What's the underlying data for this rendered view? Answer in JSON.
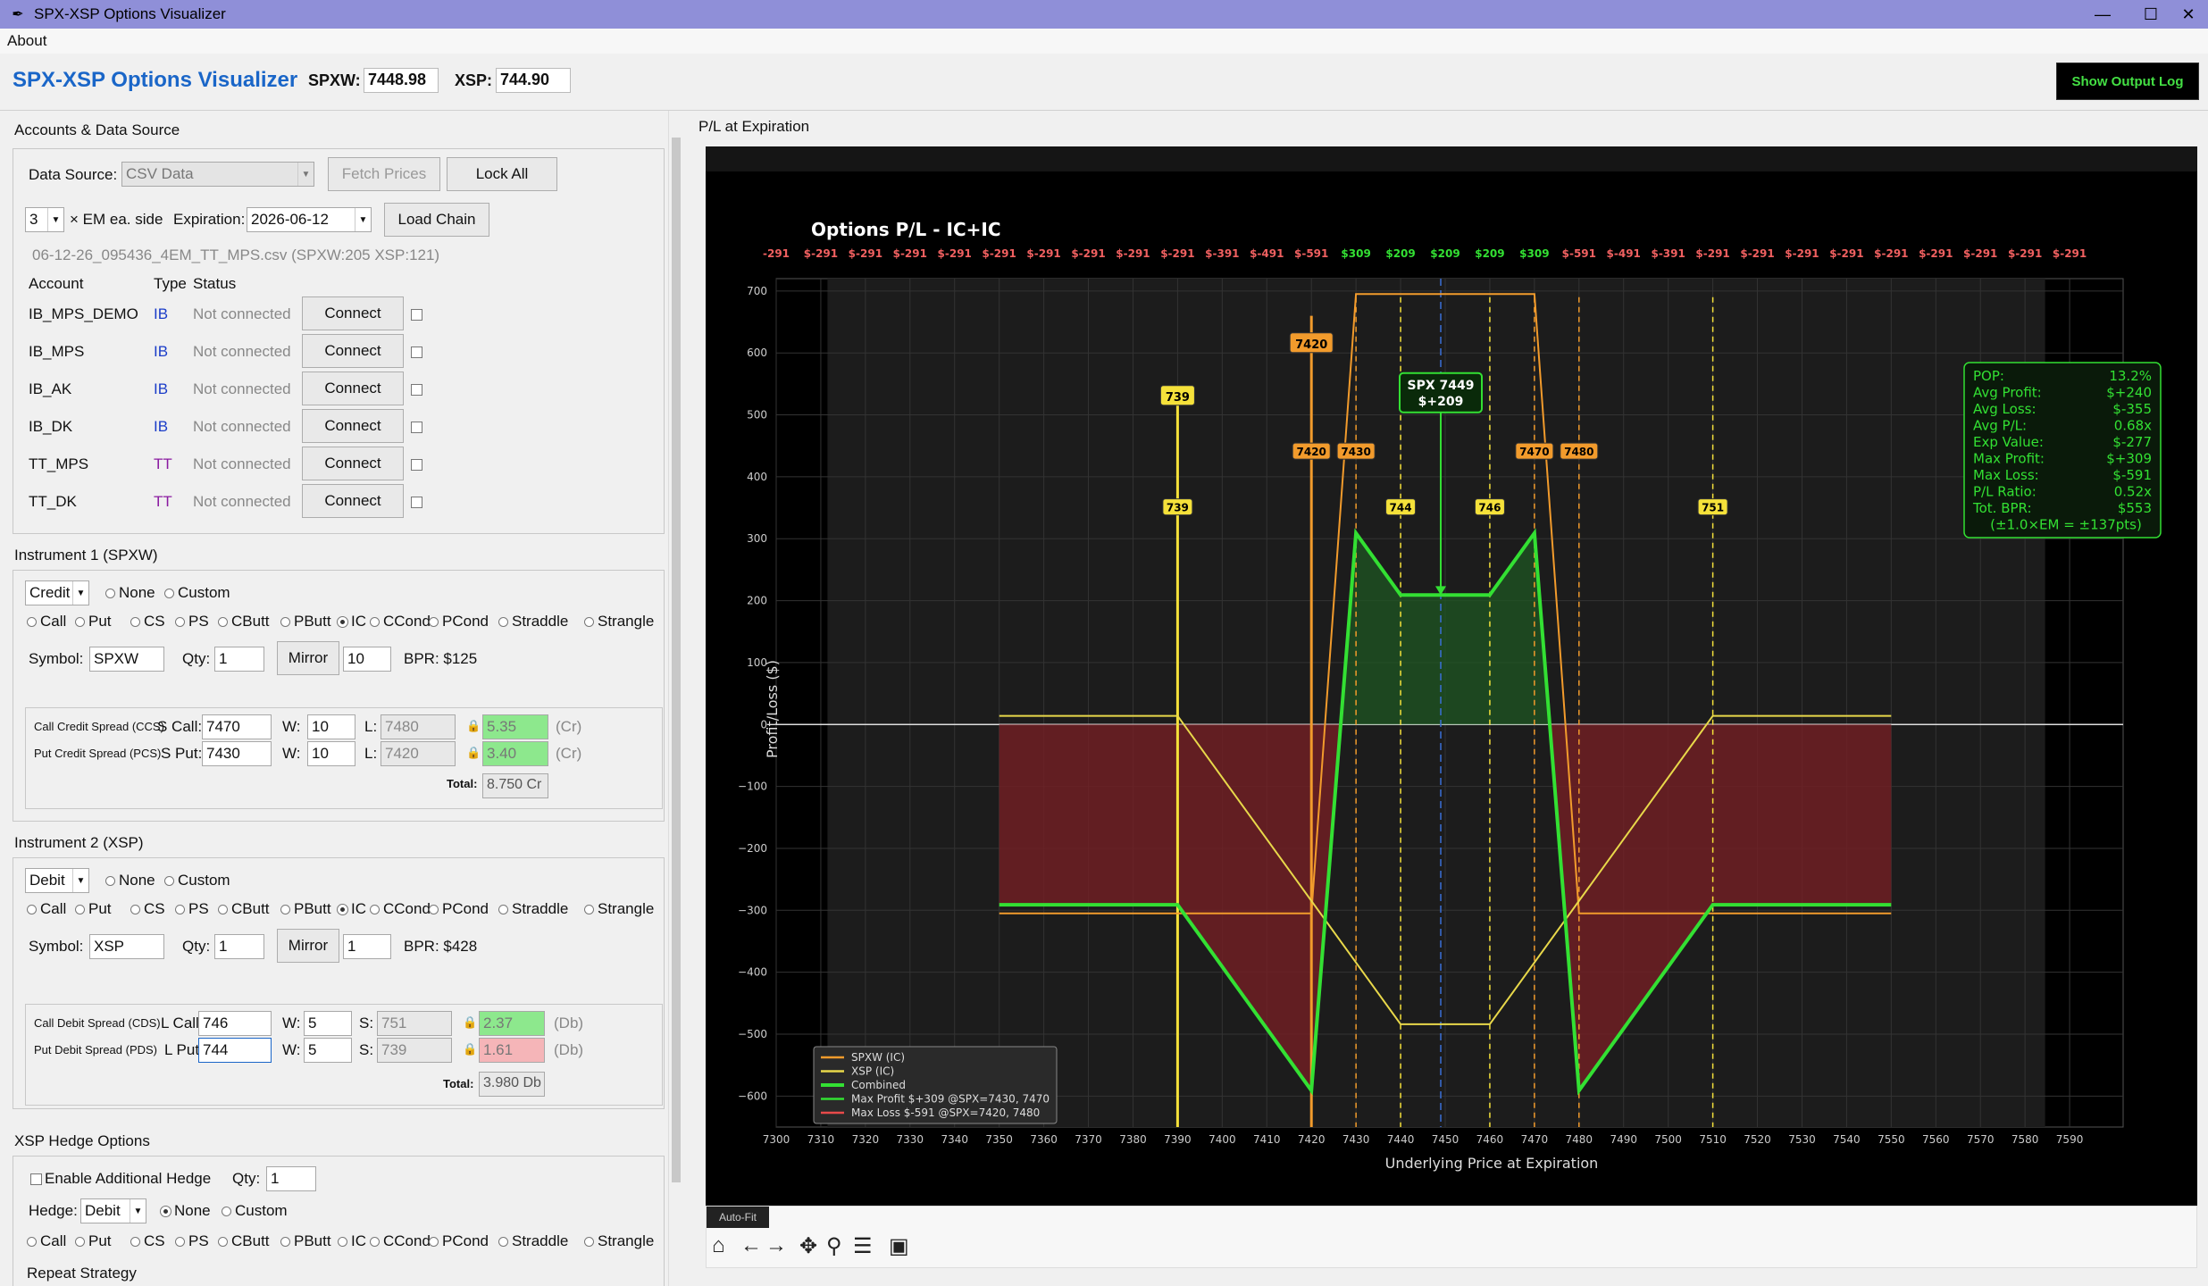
{
  "window": {
    "title": "SPX-XSP Options Visualizer",
    "min": "—",
    "max": "☐",
    "close": "✕"
  },
  "menu": {
    "about": "About"
  },
  "toolbar": {
    "app_title": "SPX-XSP Options Visualizer",
    "spxw_label": "SPXW:",
    "spxw_value": "7448.98",
    "xsp_label": "XSP:",
    "xsp_value": "744.90",
    "output_log": "Show Output Log"
  },
  "accounts": {
    "title": "Accounts & Data Source",
    "data_source_label": "Data Source:",
    "data_source_value": "CSV Data",
    "fetch_prices": "Fetch Prices",
    "lock_all": "Lock All",
    "em_value": "3",
    "em_label": "× EM ea. side",
    "expiration_label": "Expiration:",
    "expiration_value": "2026-06-12",
    "load_chain": "Load Chain",
    "csv_file": "06-12-26_095436_4EM_TT_MPS.csv (SPXW:205 XSP:121)",
    "col_account": "Account",
    "col_type": "Type",
    "col_status": "Status",
    "rows": [
      {
        "name": "IB_MPS_DEMO",
        "type": "IB",
        "status": "Not connected",
        "btn": "Connect"
      },
      {
        "name": "IB_MPS",
        "type": "IB",
        "status": "Not connected",
        "btn": "Connect"
      },
      {
        "name": "IB_AK",
        "type": "IB",
        "status": "Not connected",
        "btn": "Connect"
      },
      {
        "name": "IB_DK",
        "type": "IB",
        "status": "Not connected",
        "btn": "Connect"
      },
      {
        "name": "TT_MPS",
        "type": "TT",
        "status": "Not connected",
        "btn": "Connect"
      },
      {
        "name": "TT_DK",
        "type": "TT",
        "status": "Not connected",
        "btn": "Connect"
      }
    ]
  },
  "strategies": [
    "Call",
    "Put",
    "CS",
    "PS",
    "CButt",
    "PButt",
    "IC",
    "CCond",
    "PCond",
    "Straddle",
    "Strangle"
  ],
  "inst1": {
    "title": "Instrument 1 (SPXW)",
    "mode": "Credit",
    "none": "None",
    "custom": "Custom",
    "symbol_label": "Symbol:",
    "symbol": "SPXW",
    "qty_label": "Qty:",
    "qty": "1",
    "mirror": "Mirror",
    "mirror_val": "10",
    "bpr": "BPR: $125",
    "l1": "Call Credit Spread (CCS)",
    "l2": "Put Credit Spread (PCS)",
    "s1_label": "S Call:",
    "s1": "7470",
    "w_label": "W:",
    "w1": "10",
    "l_label": "L:",
    "lv1": "7480",
    "p1": "5.35",
    "t1": "(Cr)",
    "s2_label": "S Put:",
    "s2": "7430",
    "w2": "10",
    "lv2": "7420",
    "p2": "3.40",
    "t2": "(Cr)",
    "total_label": "Total:",
    "total": "8.750 Cr"
  },
  "inst2": {
    "title": "Instrument 2 (XSP)",
    "mode": "Debit",
    "none": "None",
    "custom": "Custom",
    "symbol_label": "Symbol:",
    "symbol": "XSP",
    "qty_label": "Qty:",
    "qty": "1",
    "mirror": "Mirror",
    "mirror_val": "1",
    "bpr": "BPR: $428",
    "l1": "Call Debit Spread (CDS)",
    "l2": "Put Debit Spread (PDS)",
    "s1_label": "L Call:",
    "s1": "746",
    "w_label": "W:",
    "w1": "5",
    "l_label": "S:",
    "lv1": "751",
    "p1": "2.37",
    "t1": "(Db)",
    "s2_label": "L Put:",
    "s2": "744",
    "w2": "5",
    "lv2": "739",
    "p2": "1.61",
    "t2": "(Db)",
    "total_label": "Total:",
    "total": "3.980 Db"
  },
  "hedge": {
    "title": "XSP Hedge Options",
    "enable": "Enable Additional Hedge",
    "qty_label": "Qty:",
    "qty": "1",
    "hedge_label": "Hedge:",
    "mode": "Debit",
    "none": "None",
    "custom": "Custom",
    "repeat": "Repeat Strategy"
  },
  "plot_panel": {
    "title": "P/L at Expiration",
    "autofit": "Auto-Fit"
  },
  "nav_icons": [
    "home-icon",
    "back-icon",
    "forward-icon",
    "pan-icon",
    "zoom-icon",
    "configure-icon",
    "save-icon"
  ],
  "chart_data": {
    "type": "line",
    "title": "Options P/L - IC+IC",
    "xlabel": "Underlying Price at Expiration",
    "ylabel": "Profit/Loss ($)",
    "xlim": [
      7300,
      7590
    ],
    "ylim": [
      -650,
      700
    ],
    "x_ticks": [
      7300,
      7310,
      7320,
      7330,
      7340,
      7350,
      7360,
      7370,
      7380,
      7390,
      7400,
      7410,
      7420,
      7430,
      7440,
      7450,
      7460,
      7470,
      7480,
      7490,
      7500,
      7510,
      7520,
      7530,
      7540,
      7550,
      7560,
      7570,
      7580,
      7590
    ],
    "y_ticks": [
      -600,
      -500,
      -400,
      -300,
      -200,
      -100,
      0,
      100,
      200,
      300,
      400,
      500,
      600,
      700
    ],
    "top_labels": [
      "-291",
      "$-291",
      "$-291",
      "$-291",
      "$-291",
      "$-291",
      "$-291",
      "$-291",
      "$-291",
      "$-291",
      "$-391",
      "$-491",
      "$-591",
      "$309",
      "$209",
      "$209",
      "$209",
      "$309",
      "$-591",
      "$-491",
      "$-391",
      "$-291",
      "$-291",
      "$-291",
      "$-291",
      "$-291",
      "$-291",
      "$-291",
      "$-291",
      "$-291"
    ],
    "series": [
      {
        "name": "SPXW (IC)",
        "color": "#f29b2c",
        "x": [
          7350,
          7420,
          7430,
          7470,
          7480,
          7550
        ],
        "y": [
          -305,
          -305,
          695,
          695,
          -305,
          -305
        ]
      },
      {
        "name": "XSP (IC)",
        "color": "#e8d84a",
        "x": [
          7350,
          7390,
          7440,
          7460,
          7510,
          7550
        ],
        "y": [
          14,
          14,
          -484,
          -484,
          14,
          14
        ]
      },
      {
        "name": "Combined",
        "color": "#33e033",
        "x": [
          7350,
          7390,
          7420,
          7430,
          7440,
          7460,
          7470,
          7480,
          7510,
          7550
        ],
        "y": [
          -291,
          -291,
          -591,
          309,
          209,
          209,
          309,
          -591,
          -291,
          -291
        ]
      }
    ],
    "legend_extra": [
      {
        "name": "Max Profit  $+309 @SPX=7430, 7470",
        "color": "#33e033"
      },
      {
        "name": "Max Loss   $-591 @SPX=7420, 7480",
        "color": "#e84a4a"
      }
    ],
    "strike_labels": [
      {
        "x": 7390,
        "label": "739",
        "y": 350,
        "color": "#f5e13a"
      },
      {
        "x": 7420,
        "label": "7420",
        "y": 440,
        "color": "#f29b2c"
      },
      {
        "x": 7430,
        "label": "7430",
        "y": 440,
        "color": "#f29b2c"
      },
      {
        "x": 7440,
        "label": "744",
        "y": 350,
        "color": "#f5e13a"
      },
      {
        "x": 7460,
        "label": "746",
        "y": 350,
        "color": "#f5e13a"
      },
      {
        "x": 7470,
        "label": "7470",
        "y": 440,
        "color": "#f29b2c"
      },
      {
        "x": 7480,
        "label": "7480",
        "y": 440,
        "color": "#f29b2c"
      },
      {
        "x": 7510,
        "label": "751",
        "y": 350,
        "color": "#f5e13a"
      }
    ],
    "big_labels": [
      {
        "x": 7390,
        "label": "739",
        "y": 530,
        "color": "#f5e13a"
      },
      {
        "x": 7420,
        "label": "7420",
        "y": 615,
        "color": "#f29b2c"
      }
    ],
    "current": {
      "x": 7449,
      "pnl": 209,
      "line1": "SPX 7449",
      "line2": "$+209"
    },
    "stats": [
      [
        "POP:",
        "13.2%"
      ],
      [
        "Avg Profit:",
        "$+240"
      ],
      [
        "Avg Loss:",
        "$-355"
      ],
      [
        "Avg P/L:",
        "0.68x"
      ],
      [
        "Exp Value:",
        "$-277"
      ],
      [
        "Max Profit:",
        "$+309"
      ],
      [
        "Max Loss:",
        "$-591"
      ],
      [
        "P/L Ratio:",
        "0.52x"
      ],
      [
        "Tot. BPR:",
        "$553"
      ]
    ],
    "stats_footer": "(±1.0×EM = ±137pts)",
    "grid": true,
    "legend_position": "bottom-left"
  }
}
